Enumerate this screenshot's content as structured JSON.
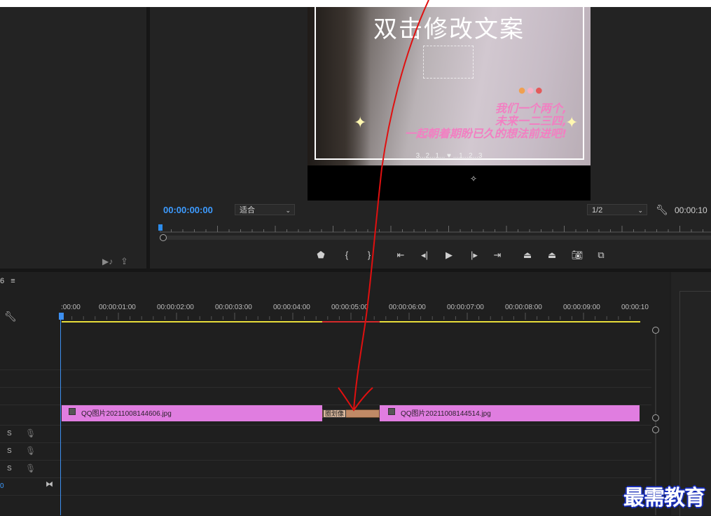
{
  "program_monitor": {
    "video": {
      "title_text": "双击修改文案",
      "caption_lines": [
        "我们一个两个,",
        "未来一二三四,",
        "一起朝着期盼已久的想法前进吧!"
      ],
      "counter_text": "3...2...1... ♥ ...1...2...3"
    },
    "current_timecode": "00:00:00:00",
    "zoom_select": "适合",
    "resolution_select": "1/2",
    "duration_timecode": "00:00:10"
  },
  "timeline": {
    "sequence_tab_suffix": "6",
    "ruler_labels": [
      ":00:00",
      "00:00:01:00",
      "00:00:02:00",
      "00:00:03:00",
      "00:00:04:00",
      "00:00:05:00",
      "00:00:06:00",
      "00:00:07:00",
      "00:00:08:00",
      "00:00:09:00",
      "00:00:10"
    ],
    "clips": [
      {
        "name": "QQ图片20211008144606.jpg"
      },
      {
        "name": "QQ图片20211008144514.jpg"
      }
    ],
    "transition_label": "圈划像",
    "audio_tracks": [
      {
        "solo": "S"
      },
      {
        "solo": "S"
      },
      {
        "solo": "S"
      }
    ],
    "master_level": "0"
  },
  "watermark": "最需教育",
  "colors": {
    "clip": "#e07de0",
    "timecode": "#3d9bff",
    "playhead": "#3d8ff0",
    "annotation": "#e01010"
  }
}
